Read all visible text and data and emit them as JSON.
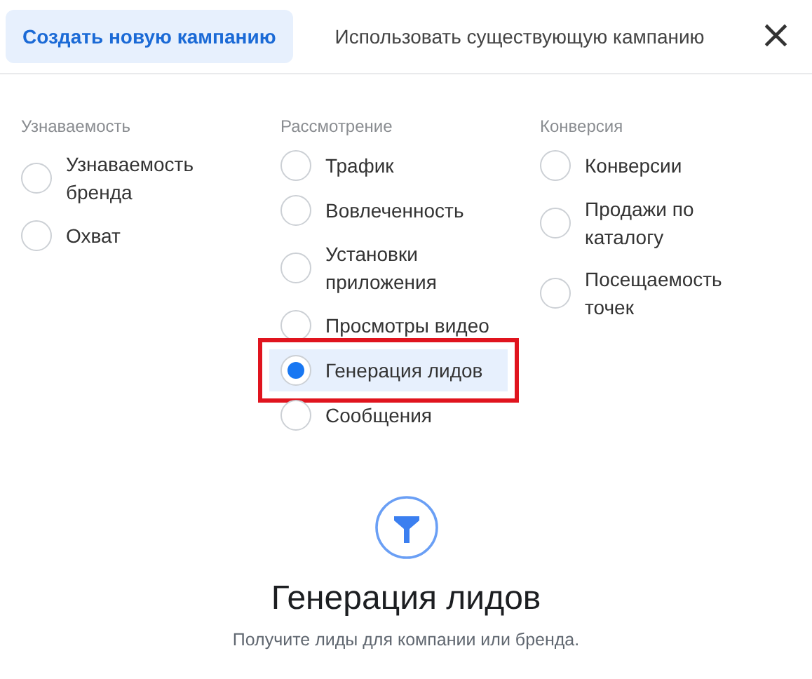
{
  "tabs": [
    {
      "label": "Создать новую кампанию",
      "selected": true
    },
    {
      "label": "Использовать существующую кампанию",
      "selected": false
    }
  ],
  "close_button": "×",
  "columns": [
    {
      "heading": "Узнаваемость",
      "options": [
        {
          "label": "Узнаваемость бренда",
          "selected": false,
          "highlighted": false
        },
        {
          "label": "Охват",
          "selected": false,
          "highlighted": false
        }
      ]
    },
    {
      "heading": "Рассмотрение",
      "options": [
        {
          "label": "Трафик",
          "selected": false,
          "highlighted": false
        },
        {
          "label": "Вовлеченность",
          "selected": false,
          "highlighted": false
        },
        {
          "label": "Установки приложения",
          "selected": false,
          "highlighted": false
        },
        {
          "label": "Просмотры видео",
          "selected": false,
          "highlighted": false
        },
        {
          "label": "Генерация лидов",
          "selected": true,
          "highlighted": true
        },
        {
          "label": "Сообщения",
          "selected": false,
          "highlighted": false
        }
      ]
    },
    {
      "heading": "Конверсия",
      "options": [
        {
          "label": "Конверсии",
          "selected": false,
          "highlighted": false
        },
        {
          "label": "Продажи по каталогу",
          "selected": false,
          "highlighted": false
        },
        {
          "label": "Посещаемость точек",
          "selected": false,
          "highlighted": false
        }
      ]
    }
  ],
  "detail": {
    "title": "Генерация лидов",
    "description": "Получите лиды для компании или бренда."
  }
}
